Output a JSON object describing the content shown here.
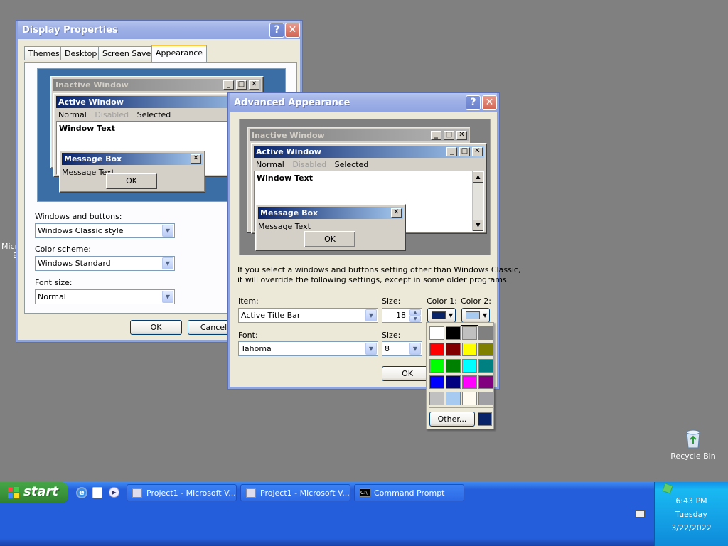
{
  "display_properties": {
    "title": "Display Properties",
    "tabs": [
      "Themes",
      "Desktop",
      "Screen Saver",
      "Appearance"
    ],
    "preview": {
      "inactive_title": "Inactive Window",
      "active_title": "Active Window",
      "menu": [
        "Normal",
        "Disabled",
        "Selected"
      ],
      "window_text": "Window Text",
      "msgbox_title": "Message Box",
      "msgbox_text": "Message Text",
      "ok": "OK"
    },
    "windows_buttons_label": "Windows and buttons:",
    "windows_buttons_value": "Windows Classic style",
    "color_scheme_label": "Color scheme:",
    "color_scheme_value": "Windows Standard",
    "font_size_label": "Font size:",
    "font_size_value": "Normal",
    "ok_label": "OK",
    "cancel_label": "Cancel"
  },
  "advanced_appearance": {
    "title": "Advanced Appearance",
    "preview": {
      "inactive_title": "Inactive Window",
      "active_title": "Active Window",
      "menu": [
        "Normal",
        "Disabled",
        "Selected"
      ],
      "window_text": "Window Text",
      "msgbox_title": "Message Box",
      "msgbox_text": "Message Text",
      "ok": "OK"
    },
    "info_text_1": "If you select a windows and buttons setting other than Windows Classic,",
    "info_text_2": "it will override the following settings, except in some older programs.",
    "item_label": "Item:",
    "item_value": "Active Title Bar",
    "item_size_label": "Size:",
    "item_size_value": "18",
    "color1_label": "Color 1:",
    "color2_label": "Color 2:",
    "font_label": "Font:",
    "font_value": "Tahoma",
    "font_size_label": "Size:",
    "font_size_value": "8",
    "ok_label": "OK",
    "color1_value": "#0a246a",
    "color2_value": "#a6caf0"
  },
  "color_popup": {
    "swatches": [
      "#ffffff",
      "#000000",
      "#c0c0c0",
      "#808080",
      "#ff0000",
      "#800000",
      "#ffff00",
      "#808000",
      "#00ff00",
      "#008000",
      "#00ffff",
      "#008080",
      "#0000ff",
      "#000080",
      "#ff00ff",
      "#800080",
      "#c0c0c0",
      "#a6caf0",
      "#fffbf0",
      "#a0a0a4"
    ],
    "selected_index": 2,
    "other_label": "Other...",
    "custom_color": "#0a246a"
  },
  "desktop": {
    "recycle_bin_label": "Recycle Bin",
    "left_icon_label_1": "Micro",
    "left_icon_label_2": "B"
  },
  "taskbar": {
    "start_label": "start",
    "items": [
      "Project1 - Microsoft V...",
      "Project1 - Microsoft V...",
      "Command Prompt"
    ],
    "time": "6:43 PM",
    "day": "Tuesday",
    "date": "3/22/2022"
  }
}
